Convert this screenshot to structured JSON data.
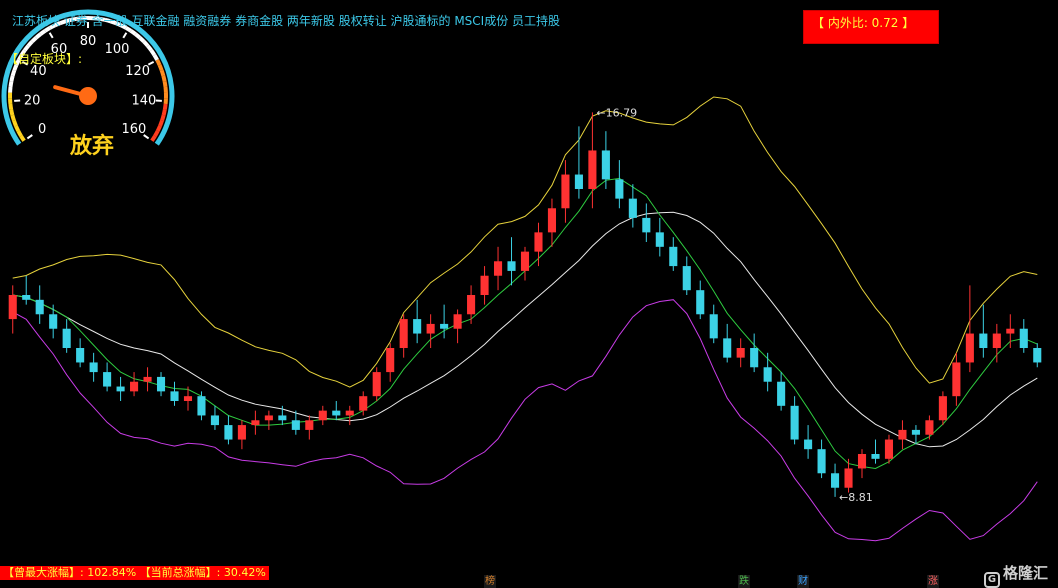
{
  "header": {
    "concepts": "江苏板块 证券 含一般 互联金融 融资融券 券商金股 两年新股 股权转让 沪股通标的 MSCI成份 员工持股",
    "panel_label": "【自定板块】:",
    "ratio": "【 内外比: 0.72 】"
  },
  "gauge": {
    "ticks": [
      "0",
      "20",
      "40",
      "60",
      "80",
      "100",
      "120",
      "140",
      "160"
    ],
    "needle_value": 32,
    "verdict": "放弃"
  },
  "bottom": {
    "max_gain_label": "【曾最大涨幅】:",
    "max_gain_value": "102.84%",
    "total_gain_label": "【当前总涨幅】:",
    "total_gain_value": "30.42%"
  },
  "markers": [
    {
      "label": "榜",
      "color": "#d07d2a"
    },
    {
      "label": "跌",
      "color": "#4cb84c"
    },
    {
      "label": "财",
      "color": "#3aa2ff"
    },
    {
      "label": "涨",
      "color": "#ff6060"
    }
  ],
  "watermark": "格隆汇",
  "chart_data": {
    "type": "candlestick",
    "ylim": [
      7.5,
      18.5
    ],
    "high_annotation": "16.79",
    "low_annotation": "8.81",
    "colors": {
      "up": "#ff3232",
      "down": "#3cd2e6",
      "ma_short": "#2ecc40",
      "mid": "#e8e8e8",
      "upper": "#e6d23c",
      "lower": "#c83ce6"
    },
    "candles": [
      [
        12.5,
        13.2,
        12.2,
        13.0
      ],
      [
        13.0,
        13.4,
        12.8,
        12.9
      ],
      [
        12.9,
        13.2,
        12.4,
        12.6
      ],
      [
        12.6,
        12.8,
        12.1,
        12.3
      ],
      [
        12.3,
        12.5,
        11.8,
        11.9
      ],
      [
        11.9,
        12.1,
        11.5,
        11.6
      ],
      [
        11.6,
        11.8,
        11.2,
        11.4
      ],
      [
        11.4,
        11.6,
        11.0,
        11.1
      ],
      [
        11.1,
        11.3,
        10.8,
        11.0
      ],
      [
        11.0,
        11.4,
        10.9,
        11.2
      ],
      [
        11.2,
        11.5,
        11.0,
        11.3
      ],
      [
        11.3,
        11.4,
        10.9,
        11.0
      ],
      [
        11.0,
        11.2,
        10.7,
        10.8
      ],
      [
        10.8,
        11.1,
        10.6,
        10.9
      ],
      [
        10.9,
        11.0,
        10.4,
        10.5
      ],
      [
        10.5,
        10.7,
        10.2,
        10.3
      ],
      [
        10.3,
        10.5,
        9.9,
        10.0
      ],
      [
        10.0,
        10.4,
        9.8,
        10.3
      ],
      [
        10.3,
        10.6,
        10.1,
        10.4
      ],
      [
        10.4,
        10.6,
        10.2,
        10.5
      ],
      [
        10.5,
        10.7,
        10.3,
        10.4
      ],
      [
        10.4,
        10.6,
        10.1,
        10.2
      ],
      [
        10.2,
        10.5,
        10.0,
        10.4
      ],
      [
        10.4,
        10.7,
        10.3,
        10.6
      ],
      [
        10.6,
        10.8,
        10.4,
        10.5
      ],
      [
        10.5,
        10.7,
        10.3,
        10.6
      ],
      [
        10.6,
        11.0,
        10.5,
        10.9
      ],
      [
        10.9,
        11.5,
        10.8,
        11.4
      ],
      [
        11.4,
        12.0,
        11.2,
        11.9
      ],
      [
        11.9,
        12.6,
        11.7,
        12.5
      ],
      [
        12.5,
        12.9,
        12.0,
        12.2
      ],
      [
        12.2,
        12.6,
        11.9,
        12.4
      ],
      [
        12.4,
        12.8,
        12.1,
        12.3
      ],
      [
        12.3,
        12.7,
        12.0,
        12.6
      ],
      [
        12.6,
        13.2,
        12.4,
        13.0
      ],
      [
        13.0,
        13.6,
        12.8,
        13.4
      ],
      [
        13.4,
        14.0,
        13.1,
        13.7
      ],
      [
        13.7,
        14.2,
        13.2,
        13.5
      ],
      [
        13.5,
        14.0,
        13.3,
        13.9
      ],
      [
        13.9,
        14.5,
        13.6,
        14.3
      ],
      [
        14.3,
        15.0,
        14.0,
        14.8
      ],
      [
        14.8,
        15.8,
        14.5,
        15.5
      ],
      [
        15.5,
        16.5,
        15.0,
        15.2
      ],
      [
        15.2,
        16.79,
        14.8,
        16.0
      ],
      [
        16.0,
        16.4,
        15.2,
        15.4
      ],
      [
        15.4,
        15.8,
        14.8,
        15.0
      ],
      [
        15.0,
        15.3,
        14.4,
        14.6
      ],
      [
        14.6,
        14.9,
        14.1,
        14.3
      ],
      [
        14.3,
        14.6,
        13.8,
        14.0
      ],
      [
        14.0,
        14.2,
        13.5,
        13.6
      ],
      [
        13.6,
        13.8,
        13.0,
        13.1
      ],
      [
        13.1,
        13.3,
        12.5,
        12.6
      ],
      [
        12.6,
        12.8,
        12.0,
        12.1
      ],
      [
        12.1,
        12.4,
        11.6,
        11.7
      ],
      [
        11.7,
        12.1,
        11.5,
        11.9
      ],
      [
        11.9,
        12.2,
        11.4,
        11.5
      ],
      [
        11.5,
        11.8,
        11.0,
        11.2
      ],
      [
        11.2,
        11.4,
        10.6,
        10.7
      ],
      [
        10.7,
        10.9,
        9.9,
        10.0
      ],
      [
        10.0,
        10.3,
        9.6,
        9.8
      ],
      [
        9.8,
        10.0,
        9.2,
        9.3
      ],
      [
        9.3,
        9.5,
        8.81,
        9.0
      ],
      [
        9.0,
        9.6,
        8.9,
        9.4
      ],
      [
        9.4,
        9.8,
        9.2,
        9.7
      ],
      [
        9.7,
        10.0,
        9.5,
        9.6
      ],
      [
        9.6,
        10.1,
        9.5,
        10.0
      ],
      [
        10.0,
        10.4,
        9.8,
        10.2
      ],
      [
        10.2,
        10.3,
        9.9,
        10.1
      ],
      [
        10.1,
        10.5,
        10.0,
        10.4
      ],
      [
        10.4,
        11.0,
        10.3,
        10.9
      ],
      [
        10.9,
        11.8,
        10.7,
        11.6
      ],
      [
        11.6,
        13.2,
        11.4,
        12.2
      ],
      [
        12.2,
        12.8,
        11.7,
        11.9
      ],
      [
        11.9,
        12.4,
        11.6,
        12.2
      ],
      [
        12.2,
        12.6,
        11.9,
        12.3
      ],
      [
        12.3,
        12.5,
        11.8,
        11.9
      ],
      [
        11.9,
        12.0,
        11.5,
        11.6
      ]
    ]
  }
}
